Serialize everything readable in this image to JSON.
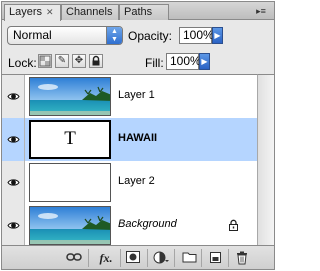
{
  "tabs": [
    {
      "label": "Layers",
      "active": true
    },
    {
      "label": "Channels",
      "active": false
    },
    {
      "label": "Paths",
      "active": false
    }
  ],
  "blend_mode": {
    "value": "Normal"
  },
  "opacity": {
    "label": "Opacity:",
    "value": "100%"
  },
  "lock": {
    "label": "Lock:"
  },
  "fill": {
    "label": "Fill:",
    "value": "100%"
  },
  "layers": [
    {
      "name": "Layer 1",
      "thumbnail": "beach-photo",
      "visible": true,
      "selected": false
    },
    {
      "name": "HAWAII",
      "thumbnail": "text-T",
      "thumb_text": "T",
      "visible": true,
      "selected": true
    },
    {
      "name": "Layer 2",
      "thumbnail": "blank-white",
      "visible": true,
      "selected": false
    },
    {
      "name": "Background",
      "thumbnail": "beach-photo",
      "visible": true,
      "selected": false,
      "locked": true
    }
  ],
  "colors": {
    "selected_row": "#b5d5ff",
    "panel_bg": "#e8e8e8",
    "accent_blue": "#2f6fd0"
  },
  "toolbar_icons": [
    "link-layers-icon",
    "fx-icon",
    "add-mask-icon",
    "adjustment-layer-icon",
    "new-group-icon",
    "new-layer-icon",
    "trash-icon"
  ]
}
